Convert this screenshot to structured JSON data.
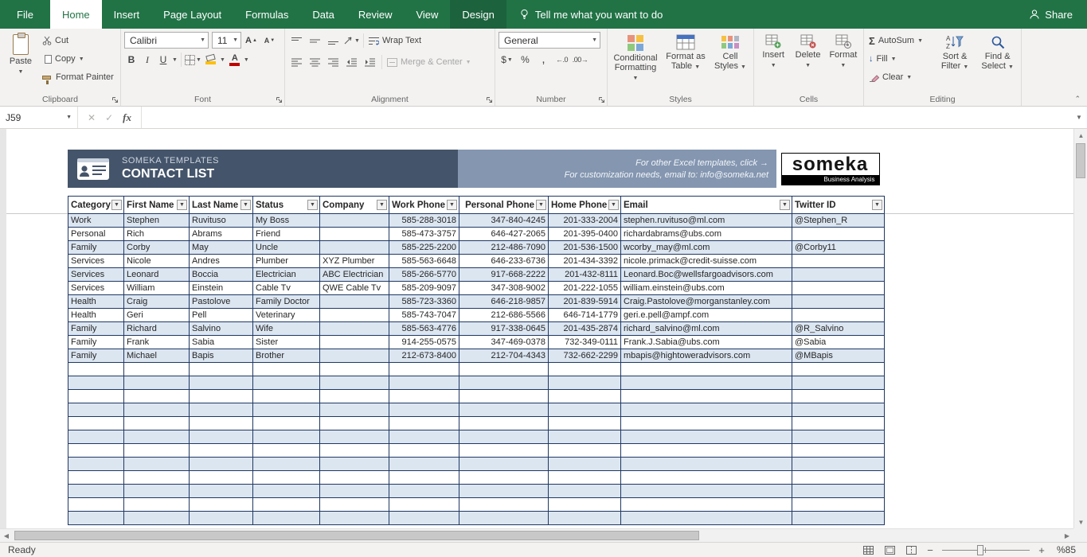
{
  "ribbon": {
    "tabs": [
      {
        "label": "File"
      },
      {
        "label": "Home"
      },
      {
        "label": "Insert"
      },
      {
        "label": "Page Layout"
      },
      {
        "label": "Formulas"
      },
      {
        "label": "Data"
      },
      {
        "label": "Review"
      },
      {
        "label": "View"
      },
      {
        "label": "Design"
      }
    ],
    "tell_me": "Tell me what you want to do",
    "share": "Share",
    "groups": {
      "clipboard": {
        "label": "Clipboard",
        "paste": "Paste",
        "cut": "Cut",
        "copy": "Copy",
        "format_painter": "Format Painter"
      },
      "font": {
        "label": "Font",
        "name": "Calibri",
        "size": "11",
        "bold": "B",
        "italic": "I",
        "underline": "U"
      },
      "alignment": {
        "label": "Alignment",
        "wrap": "Wrap Text",
        "merge": "Merge & Center"
      },
      "number": {
        "label": "Number",
        "format": "General",
        "currency": "$",
        "percent": "%",
        "comma": ",",
        "inc_decimal": "←.0",
        "dec_decimal": ".00→"
      },
      "styles": {
        "label": "Styles",
        "conditional_1": "Conditional",
        "conditional_2": "Formatting",
        "table_1": "Format as",
        "table_2": "Table",
        "cellstyles_1": "Cell",
        "cellstyles_2": "Styles"
      },
      "cells": {
        "label": "Cells",
        "insert": "Insert",
        "delete": "Delete",
        "format": "Format"
      },
      "editing": {
        "label": "Editing",
        "autosum_icon": "Σ",
        "autosum": "AutoSum",
        "fill": "Fill",
        "clear": "Clear",
        "sort_1": "Sort &",
        "sort_2": "Filter",
        "find_1": "Find &",
        "find_2": "Select"
      }
    }
  },
  "formula_bar": {
    "name_box": "J59",
    "fx": "fx"
  },
  "banner": {
    "brand": "SOMEKA TEMPLATES",
    "title": "CONTACT LIST",
    "promo_line1": "For other Excel templates, click →",
    "promo_line2": "For customization needs, email to: info@someka.net",
    "logo": "someka",
    "logo_sub": "Business Analysis"
  },
  "table": {
    "columns": [
      "Category",
      "First Name",
      "Last Name",
      "Status",
      "Company",
      "Work Phone",
      "Personal Phone",
      "Home Phone",
      "Email",
      "Twitter ID"
    ],
    "rows": [
      [
        "Work",
        "Stephen",
        "Ruvituso",
        "My Boss",
        "",
        "585-288-3018",
        "347-840-4245",
        "201-333-2004",
        "stephen.ruvituso@ml.com",
        "@Stephen_R"
      ],
      [
        "Personal",
        "Rich",
        "Abrams",
        "Friend",
        "",
        "585-473-3757",
        "646-427-2065",
        "201-395-0400",
        "richardabrams@ubs.com",
        ""
      ],
      [
        "Family",
        "Corby",
        "May",
        "Uncle",
        "",
        "585-225-2200",
        "212-486-7090",
        "201-536-1500",
        "wcorby_may@ml.com",
        "@Corby11"
      ],
      [
        "Services",
        "Nicole",
        "Andres",
        "Plumber",
        "XYZ Plumber",
        "585-563-6648",
        "646-233-6736",
        "201-434-3392",
        "nicole.primack@credit-suisse.com",
        ""
      ],
      [
        "Services",
        "Leonard",
        "Boccia",
        "Electrician",
        "ABC Electrician",
        "585-266-5770",
        "917-668-2222",
        "201-432-8111",
        "Leonard.Boc@wellsfargoadvisors.com",
        ""
      ],
      [
        "Services",
        "William",
        "Einstein",
        "Cable Tv",
        "QWE Cable Tv",
        "585-209-9097",
        "347-308-9002",
        "201-222-1055",
        "william.einstein@ubs.com",
        ""
      ],
      [
        "Health",
        "Craig",
        "Pastolove",
        "Family Doctor",
        "",
        "585-723-3360",
        "646-218-9857",
        "201-839-5914",
        "Craig.Pastolove@morganstanley.com",
        ""
      ],
      [
        "Health",
        "Geri",
        "Pell",
        "Veterinary",
        "",
        "585-743-7047",
        "212-686-5566",
        "646-714-1779",
        "geri.e.pell@ampf.com",
        ""
      ],
      [
        "Family",
        "Richard",
        "Salvino",
        "Wife",
        "",
        "585-563-4776",
        "917-338-0645",
        "201-435-2874",
        "richard_salvino@ml.com",
        "@R_Salvino"
      ],
      [
        "Family",
        "Frank",
        "Sabia",
        "Sister",
        "",
        "914-255-0575",
        "347-469-0378",
        "732-349-0111",
        "Frank.J.Sabia@ubs.com",
        "@Sabia"
      ],
      [
        "Family",
        "Michael",
        "Bapis",
        "Brother",
        "",
        "212-673-8400",
        "212-704-4343",
        "732-662-2299",
        "mbapis@hightoweradvisors.com",
        "@MBapis"
      ]
    ],
    "empty_row_count": 12
  },
  "status_bar": {
    "ready": "Ready",
    "zoom": "%85"
  },
  "colors": {
    "excel_green": "#217346",
    "banner_dark": "#44546a",
    "banner_promo": "#8496b0",
    "band": "#dce6f1",
    "table_border": "#203864",
    "fill_yellow": "#ffc000",
    "font_red": "#c00000"
  }
}
